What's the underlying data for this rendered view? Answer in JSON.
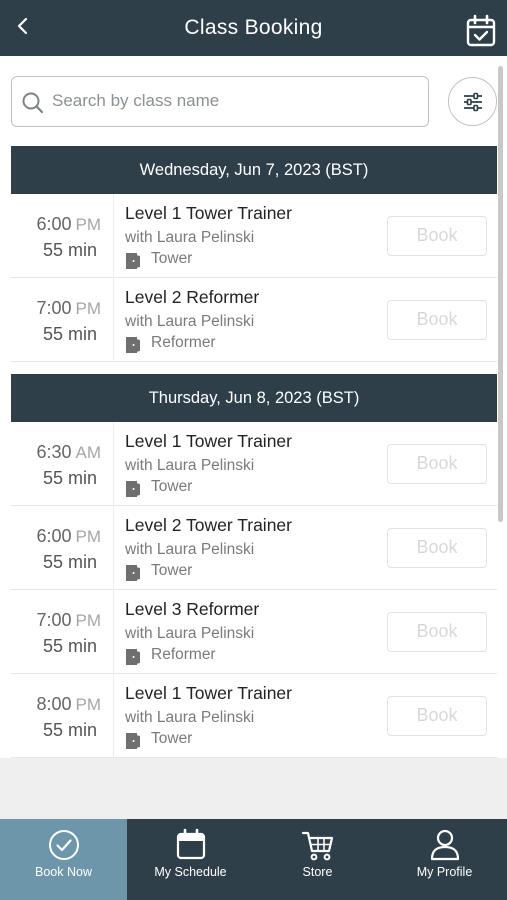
{
  "header": {
    "title": "Class Booking"
  },
  "search": {
    "placeholder": "Search by class name",
    "value": ""
  },
  "days": [
    {
      "label": "Wednesday, Jun 7, 2023 (BST)",
      "classes": [
        {
          "time": "6:00",
          "ampm": "PM",
          "duration": "55 min",
          "name": "Level 1 Tower Trainer",
          "instructor": "with Laura Pelinski",
          "room": "Tower",
          "book_label": "Book"
        },
        {
          "time": "7:00",
          "ampm": "PM",
          "duration": "55 min",
          "name": "Level 2 Reformer",
          "instructor": "with Laura Pelinski",
          "room": "Reformer",
          "book_label": "Book"
        }
      ]
    },
    {
      "label": "Thursday, Jun 8, 2023 (BST)",
      "classes": [
        {
          "time": "6:30",
          "ampm": "AM",
          "duration": "55 min",
          "name": "Level 1 Tower Trainer",
          "instructor": "with Laura Pelinski",
          "room": "Tower",
          "book_label": "Book"
        },
        {
          "time": "6:00",
          "ampm": "PM",
          "duration": "55 min",
          "name": "Level 2 Tower Trainer",
          "instructor": "with Laura Pelinski",
          "room": "Tower",
          "book_label": "Book"
        },
        {
          "time": "7:00",
          "ampm": "PM",
          "duration": "55 min",
          "name": "Level 3 Reformer",
          "instructor": "with Laura Pelinski",
          "room": "Reformer",
          "book_label": "Book"
        },
        {
          "time": "8:00",
          "ampm": "PM",
          "duration": "55 min",
          "name": "Level 1 Tower Trainer",
          "instructor": "with Laura Pelinski",
          "room": "Tower",
          "book_label": "Book"
        }
      ]
    }
  ],
  "tabs": [
    {
      "label": "Book Now",
      "icon": "check-circle-icon",
      "active": true
    },
    {
      "label": "My Schedule",
      "icon": "calendar-icon",
      "active": false
    },
    {
      "label": "Store",
      "icon": "cart-icon",
      "active": false
    },
    {
      "label": "My Profile",
      "icon": "person-icon",
      "active": false
    }
  ],
  "colors": {
    "header_bg": "#2e3f4a",
    "active_tab_bg": "#6e96aa"
  }
}
